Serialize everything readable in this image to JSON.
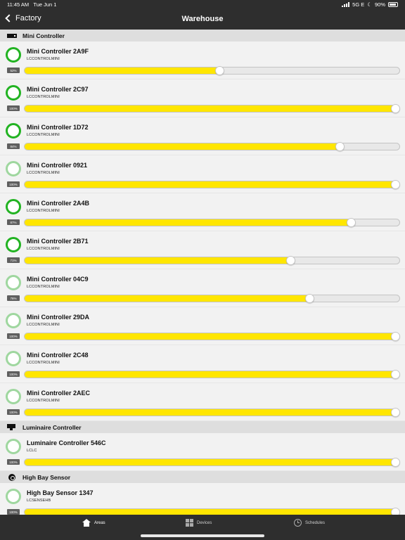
{
  "status": {
    "time": "11:45 AM",
    "date": "Tue Jun 1",
    "network": "5G E",
    "battery": "90%"
  },
  "nav": {
    "back_label": "Factory",
    "title": "Warehouse"
  },
  "sections": [
    {
      "title": "Mini Controller",
      "icon": "mini-controller-icon",
      "devices": [
        {
          "name": "Mini Controller 2A9F",
          "type": "LCCONTROLMINI",
          "level_label": "52%",
          "level": 52,
          "ring": "bright"
        },
        {
          "name": "Mini Controller 2C97",
          "type": "LCCONTROLMINI",
          "level_label": "100%",
          "level": 100,
          "ring": "bright"
        },
        {
          "name": "Mini Controller 1D72",
          "type": "LCCONTROLMINI",
          "level_label": "84%",
          "level": 84,
          "ring": "bright"
        },
        {
          "name": "Mini Controller 0921",
          "type": "LCCONTROLMINI",
          "level_label": "100%",
          "level": 100,
          "ring": "pale"
        },
        {
          "name": "Mini Controller 2A4B",
          "type": "LCCONTROLMINI",
          "level_label": "87%",
          "level": 87,
          "ring": "bright"
        },
        {
          "name": "Mini Controller 2B71",
          "type": "LCCONTROLMINI",
          "level_label": "71%",
          "level": 71,
          "ring": "bright"
        },
        {
          "name": "Mini Controller 04C9",
          "type": "LCCONTROLMINI",
          "level_label": "76%",
          "level": 76,
          "ring": "pale"
        },
        {
          "name": "Mini Controller 29DA",
          "type": "LCCONTROLMINI",
          "level_label": "100%",
          "level": 100,
          "ring": "pale"
        },
        {
          "name": "Mini Controller 2C48",
          "type": "LCCONTROLMINI",
          "level_label": "100%",
          "level": 100,
          "ring": "pale"
        },
        {
          "name": "Mini Controller 2AEC",
          "type": "LCCONTROLMINI",
          "level_label": "100%",
          "level": 100,
          "ring": "pale"
        }
      ]
    },
    {
      "title": "Luminaire Controller",
      "icon": "luminaire-controller-icon",
      "devices": [
        {
          "name": "Luminaire Controller 546C",
          "type": "LCLC",
          "level_label": "100%",
          "level": 100,
          "ring": "pale"
        }
      ]
    },
    {
      "title": "High Bay Sensor",
      "icon": "high-bay-sensor-icon",
      "devices": [
        {
          "name": "High Bay Sensor 1347",
          "type": "LCSENSEHB",
          "level_label": "100%",
          "level": 100,
          "ring": "pale"
        }
      ]
    }
  ],
  "tabs": {
    "areas": "Areas",
    "devices": "Devices",
    "schedules": "Schedules"
  },
  "colors": {
    "bar": "#2e2e2e",
    "fill": "#ffe600",
    "ring_on": "#22b322",
    "ring_pale": "#9fd79f"
  }
}
